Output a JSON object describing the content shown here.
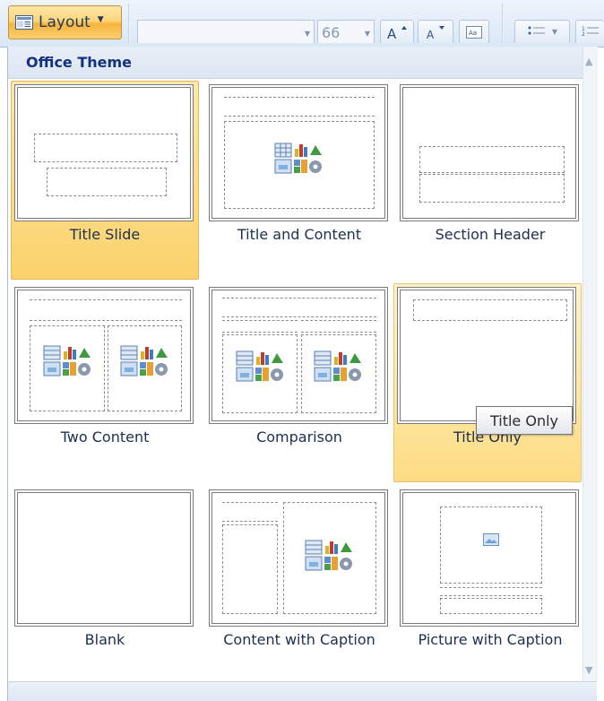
{
  "ribbon": {
    "layout_label": "Layout",
    "font_size": "66"
  },
  "gallery": {
    "title": "Office Theme",
    "layouts": [
      {
        "label": "Title Slide",
        "state": "selected"
      },
      {
        "label": "Title and Content",
        "state": "normal"
      },
      {
        "label": "Section Header",
        "state": "normal"
      },
      {
        "label": "Two Content",
        "state": "normal"
      },
      {
        "label": "Comparison",
        "state": "normal"
      },
      {
        "label": "Title Only",
        "state": "hover"
      },
      {
        "label": "Blank",
        "state": "normal"
      },
      {
        "label": "Content with Caption",
        "state": "normal"
      },
      {
        "label": "Picture with Caption",
        "state": "normal"
      }
    ]
  },
  "tooltip": {
    "text": "Title Only"
  },
  "icons": {
    "layout": "layout-icon",
    "grow_font": "grow-font-icon",
    "shrink_font": "shrink-font-icon",
    "clear_format": "clear-formatting-icon",
    "bullets": "bullets-icon",
    "numbering": "numbering-icon",
    "content": "content-placeholder-icon",
    "picture": "picture-placeholder-icon"
  },
  "colors": {
    "selected_fill": "#fbd16c",
    "hover_fill": "#fddc84",
    "header_text": "#15317e"
  }
}
